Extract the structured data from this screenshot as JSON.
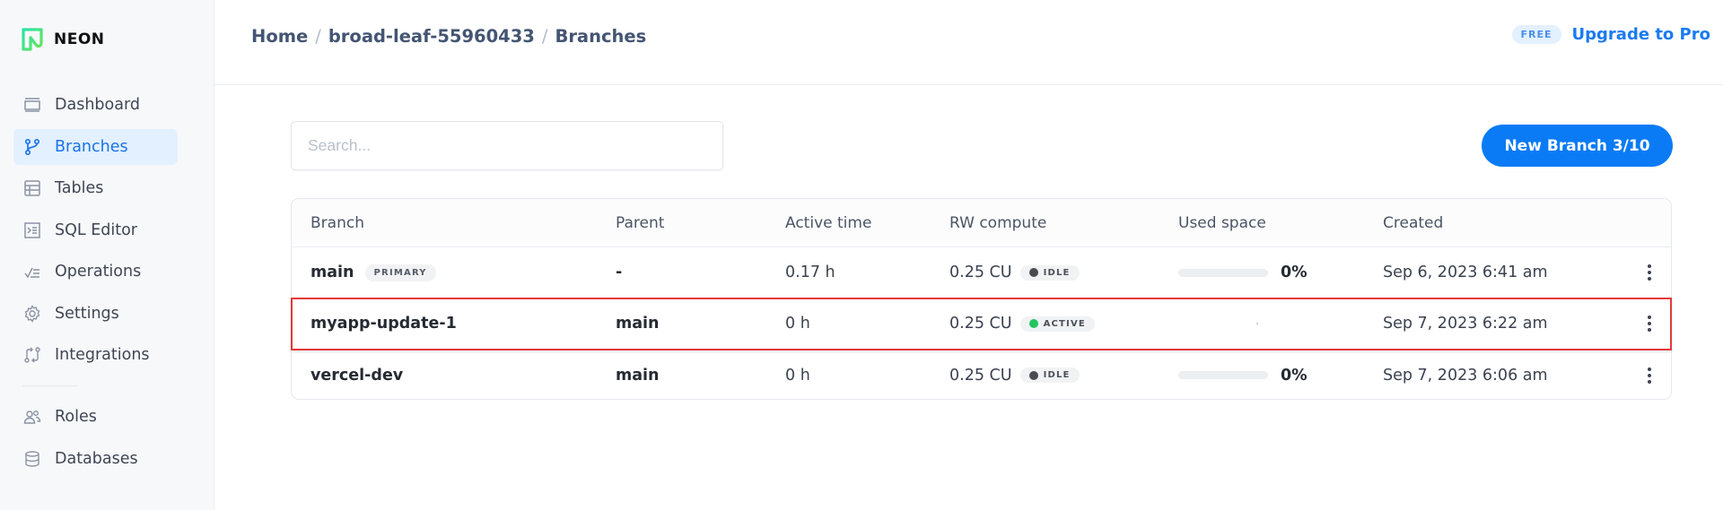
{
  "brand": {
    "name": "NEON",
    "logo_color": "#3ee58f"
  },
  "sidebar": {
    "items": [
      {
        "label": "Dashboard",
        "icon": "dashboard-icon",
        "active": false
      },
      {
        "label": "Branches",
        "icon": "branch-icon",
        "active": true
      },
      {
        "label": "Tables",
        "icon": "table-icon",
        "active": false
      },
      {
        "label": "SQL Editor",
        "icon": "terminal-icon",
        "active": false
      },
      {
        "label": "Operations",
        "icon": "operations-icon",
        "active": false
      },
      {
        "label": "Settings",
        "icon": "gear-icon",
        "active": false
      },
      {
        "label": "Integrations",
        "icon": "integrations-icon",
        "active": false
      }
    ],
    "secondary_items": [
      {
        "label": "Roles",
        "icon": "users-icon"
      },
      {
        "label": "Databases",
        "icon": "database-icon"
      }
    ]
  },
  "header": {
    "breadcrumb": [
      "Home",
      "broad-leaf-55960433",
      "Branches"
    ],
    "separator": "/",
    "plan_badge": "FREE",
    "upgrade_label": "Upgrade to Pro"
  },
  "toolbar": {
    "search_placeholder": "Search...",
    "search_value": "",
    "new_branch_label": "New Branch 3/10"
  },
  "table": {
    "columns": [
      "Branch",
      "Parent",
      "Active time",
      "RW compute",
      "Used space",
      "Created"
    ],
    "rows": [
      {
        "branch": "main",
        "badge": "PRIMARY",
        "parent": "-",
        "active_time": "0.17 h",
        "compute": "0.25 CU",
        "status": "IDLE",
        "status_color": "#4a4a52",
        "used_space_fraction": 0,
        "used_space_label": "0%",
        "created": "Sep 6, 2023 6:41 am",
        "highlighted": false
      },
      {
        "branch": "myapp-update-1",
        "badge": "",
        "parent": "main",
        "active_time": "0 h",
        "compute": "0.25 CU",
        "status": "ACTIVE",
        "status_color": "#22c55e",
        "used_space_fraction": null,
        "used_space_label": "",
        "created": "Sep 7, 2023 6:22 am",
        "highlighted": true
      },
      {
        "branch": "vercel-dev",
        "badge": "",
        "parent": "main",
        "active_time": "0 h",
        "compute": "0.25 CU",
        "status": "IDLE",
        "status_color": "#4a4a52",
        "used_space_fraction": 0,
        "used_space_label": "0%",
        "created": "Sep 7, 2023 6:06 am",
        "highlighted": false
      }
    ]
  },
  "colors": {
    "accent": "#0a7bf5",
    "highlight_border": "#e5383b",
    "active_nav_bg": "#e3f0ff"
  }
}
